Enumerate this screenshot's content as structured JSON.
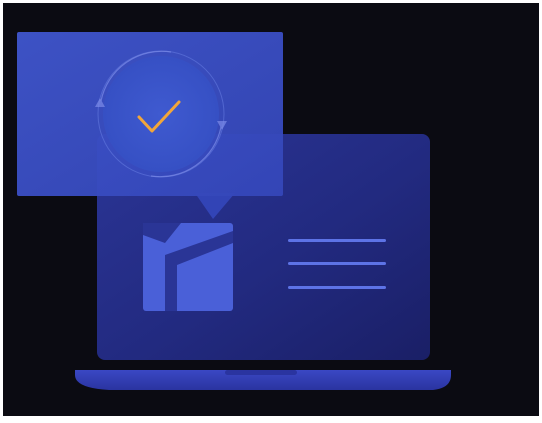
{
  "illustration": {
    "subject": "laptop-with-verified-document",
    "colors": {
      "background": "#0b0b12",
      "outer_frame": "#ffffff",
      "laptop_screen_light": "#2f3aa0",
      "laptop_screen_dark": "#1c1f6a",
      "laptop_base": "#3340b8",
      "card": "#3a4cc4",
      "card_dark": "#2836a8",
      "circle": "#3b55c8",
      "checkmark": "#f2a63a",
      "doc_icon": "#4a60d8",
      "doc_lines": "#6a7ff0"
    },
    "icons": {
      "check": "checkmark-icon",
      "document": "document-logo-icon",
      "refresh": "refresh-ring-icon"
    }
  }
}
